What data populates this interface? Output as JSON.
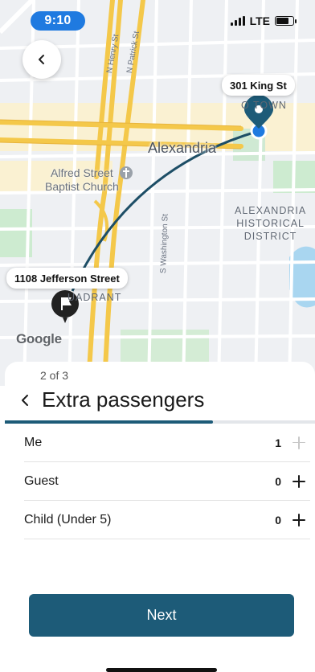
{
  "status_bar": {
    "time": "9:10",
    "network": "LTE",
    "battery_level": 0.75
  },
  "map": {
    "destination_label": "301 King St",
    "origin_label": "1108 Jefferson Street",
    "city_label": "Alexandria",
    "church_label_line1": "Alfred Street",
    "church_label_line2": "Baptist Church",
    "district_line1": "ALEXANDRIA",
    "district_line2": "HISTORICAL",
    "district_line3": "DISTRICT",
    "oldtown_partial": "O    TOWN",
    "quadrant_line1": "ST",
    "quadrant_line2": "UADRANT",
    "street_henry": "N Henry St",
    "street_patrick": "N Patrick St",
    "street_washington": "S Washington St",
    "attribution": "Google",
    "icons": [
      "chevron-left-icon",
      "flag-icon",
      "location-pin-icon",
      "church-icon"
    ]
  },
  "sheet": {
    "step": "2 of 3",
    "title": "Extra passengers",
    "progress": 0.67,
    "passengers": [
      {
        "label": "Me",
        "count": "1",
        "plus_enabled": false
      },
      {
        "label": "Guest",
        "count": "0",
        "plus_enabled": true
      },
      {
        "label": "Child (Under 5)",
        "count": "0",
        "plus_enabled": true
      }
    ],
    "next_label": "Next"
  },
  "colors": {
    "primary": "#1d5b78",
    "status_pill": "#1f7ae0",
    "route": "#1d4e66",
    "major_road": "#f4c84a"
  }
}
